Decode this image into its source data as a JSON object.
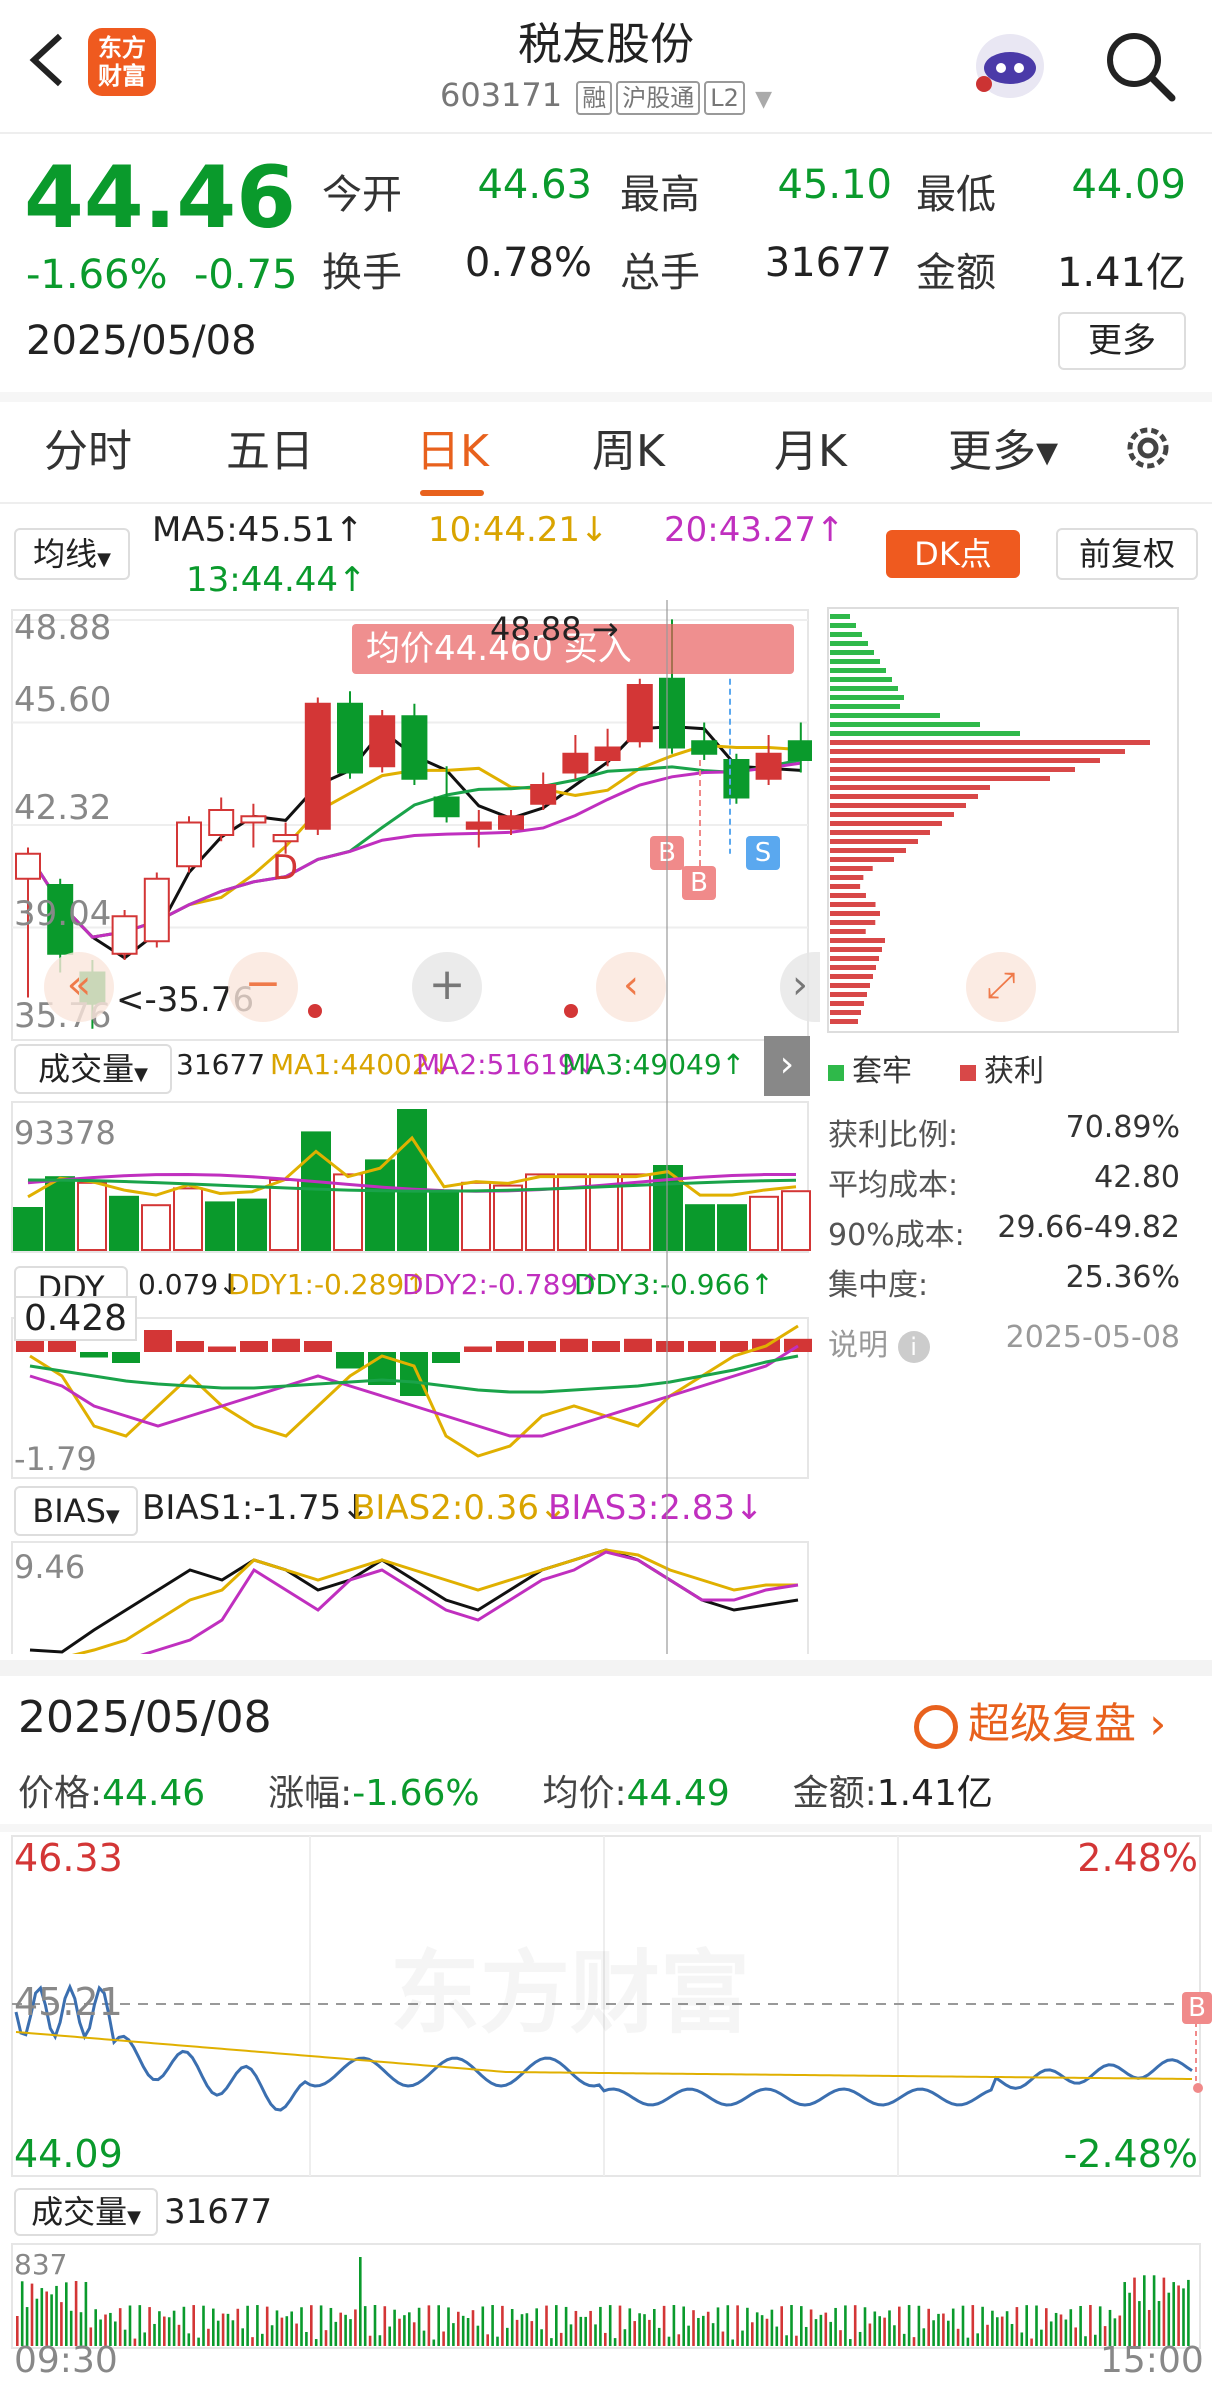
{
  "header": {
    "logo_text": "东方\n财富",
    "stock_name": "税友股份",
    "stock_code": "603171",
    "tags": [
      "融",
      "沪股通",
      "L2"
    ]
  },
  "quote": {
    "price": "44.46",
    "change_pct": "-1.66%",
    "change": "-0.75",
    "date": "2025/05/08",
    "stats": [
      {
        "label": "今开",
        "value": "44.63",
        "color": "green"
      },
      {
        "label": "最高",
        "value": "45.10",
        "color": "green"
      },
      {
        "label": "最低",
        "value": "44.09",
        "color": "green"
      },
      {
        "label": "换手",
        "value": "0.78%",
        "color": "black"
      },
      {
        "label": "总手",
        "value": "31677",
        "color": "black"
      },
      {
        "label": "金额",
        "value": "1.41亿",
        "color": "black"
      }
    ],
    "more_label": "更多"
  },
  "tabs": [
    {
      "label": "分时",
      "active": false
    },
    {
      "label": "五日",
      "active": false
    },
    {
      "label": "日K",
      "active": true
    },
    {
      "label": "周K",
      "active": false
    },
    {
      "label": "月K",
      "active": false
    },
    {
      "label": "更多▾",
      "active": false
    }
  ],
  "ma_bar": {
    "selector": "均线",
    "ma5": "MA5:45.51↑",
    "ma10": "10:44.21↓",
    "ma20": "20:43.27↑",
    "ma13": "13:44.44↑",
    "dk_label": "DK点",
    "fq_label": "前复权"
  },
  "kline": {
    "y_labels": [
      "48.88",
      "45.60",
      "42.32",
      "39.04",
      "35.76"
    ],
    "high_marker": "48.88 →",
    "low_marker": "<-35.76",
    "tooltip": "均价44.460  买入",
    "d_marker": "D",
    "b_marker": "B",
    "s_marker": "S",
    "candles": [
      [
        40.6,
        41.4,
        36.8,
        41.6
      ],
      [
        40.4,
        38.2,
        37.6,
        40.6
      ],
      [
        37.6,
        36.6,
        35.8,
        38.0
      ],
      [
        38.2,
        39.4,
        38.0,
        39.6
      ],
      [
        38.6,
        40.6,
        38.4,
        40.8
      ],
      [
        41.0,
        42.4,
        40.8,
        42.6
      ],
      [
        42.0,
        42.8,
        41.8,
        43.2
      ],
      [
        42.4,
        42.6,
        41.6,
        43.0
      ],
      [
        41.8,
        42.0,
        41.4,
        42.4
      ],
      [
        42.2,
        46.2,
        42.0,
        46.4
      ],
      [
        46.2,
        44.0,
        43.8,
        46.6
      ],
      [
        44.2,
        45.8,
        44.0,
        46.0
      ],
      [
        45.8,
        43.8,
        43.6,
        46.2
      ],
      [
        43.2,
        42.6,
        42.4,
        44.2
      ],
      [
        42.2,
        42.4,
        41.6,
        42.8
      ],
      [
        42.2,
        42.6,
        42.0,
        42.8
      ],
      [
        43.0,
        43.6,
        42.8,
        44.0
      ],
      [
        44.0,
        44.6,
        43.8,
        45.2
      ],
      [
        44.4,
        44.8,
        44.2,
        45.4
      ],
      [
        45.0,
        46.8,
        44.8,
        47.0
      ],
      [
        47.0,
        44.8,
        44.6,
        48.9
      ],
      [
        45.0,
        44.6,
        44.4,
        45.6
      ],
      [
        44.4,
        43.2,
        43.0,
        44.6
      ],
      [
        43.8,
        44.6,
        43.6,
        45.2
      ],
      [
        45.0,
        44.4,
        44.0,
        45.6
      ]
    ]
  },
  "chip_panel": {
    "legend_trapped": "套牢",
    "legend_profit": "获利",
    "rows": [
      {
        "label": "获利比例:",
        "value": "70.89%"
      },
      {
        "label": "平均成本:",
        "value": "42.80"
      },
      {
        "label": "90%成本:",
        "value": "29.66-49.82"
      },
      {
        "label": "集中度:",
        "value": "25.36%"
      }
    ],
    "note_label": "说明",
    "note_date": "2025-05-08"
  },
  "volume": {
    "selector": "成交量",
    "value": "31677",
    "ma1": "MA1:44002↓",
    "ma2": "MA2:51619↓",
    "ma3": "MA3:49049↑",
    "y_label": "93378",
    "bars": [
      {
        "v": 30,
        "up": false
      },
      {
        "v": 52,
        "up": false
      },
      {
        "v": 48,
        "up": true
      },
      {
        "v": 38,
        "up": false
      },
      {
        "v": 32,
        "up": true
      },
      {
        "v": 44,
        "up": true
      },
      {
        "v": 34,
        "up": false
      },
      {
        "v": 36,
        "up": false
      },
      {
        "v": 50,
        "up": true
      },
      {
        "v": 84,
        "up": false
      },
      {
        "v": 54,
        "up": true
      },
      {
        "v": 64,
        "up": false
      },
      {
        "v": 100,
        "up": false
      },
      {
        "v": 42,
        "up": false
      },
      {
        "v": 48,
        "up": true
      },
      {
        "v": 46,
        "up": true
      },
      {
        "v": 54,
        "up": true
      },
      {
        "v": 54,
        "up": true
      },
      {
        "v": 54,
        "up": true
      },
      {
        "v": 54,
        "up": true
      },
      {
        "v": 60,
        "up": false
      },
      {
        "v": 32,
        "up": false
      },
      {
        "v": 32,
        "up": false
      },
      {
        "v": 38,
        "up": true
      },
      {
        "v": 42,
        "up": true
      }
    ]
  },
  "ddy": {
    "selector": "DDY",
    "value": "0.079↓",
    "ddy1": "DDY1:-0.289↑",
    "ddy2": "DDY2:-0.789↑",
    "ddy3": "DDY3:-0.966↑",
    "y_top": "0.428",
    "y_bottom": "-1.79"
  },
  "bias": {
    "selector": "BIAS",
    "bias1": "BIAS1:-1.75↓",
    "bias2": "BIAS2:0.36↓",
    "bias3": "BIAS3:2.83↓",
    "y_label": "9.46"
  },
  "intraday": {
    "date": "2025/05/08",
    "replay_label": "超级复盘",
    "price_label": "价格:",
    "price": "44.46",
    "change_label": "涨幅:",
    "change": "-1.66%",
    "avg_label": "均价:",
    "avg": "44.49",
    "amount_label": "金额:",
    "amount": "1.41亿",
    "y_high": "46.33",
    "y_mid": "45.21",
    "y_low": "44.09",
    "pct_high": "2.48%",
    "pct_low": "-2.48%",
    "b_marker": "B",
    "vol_selector": "成交量",
    "vol_value": "31677",
    "vol_y": "837",
    "time_start": "09:30",
    "time_end": "15:00",
    "watermark": "东方财富"
  }
}
